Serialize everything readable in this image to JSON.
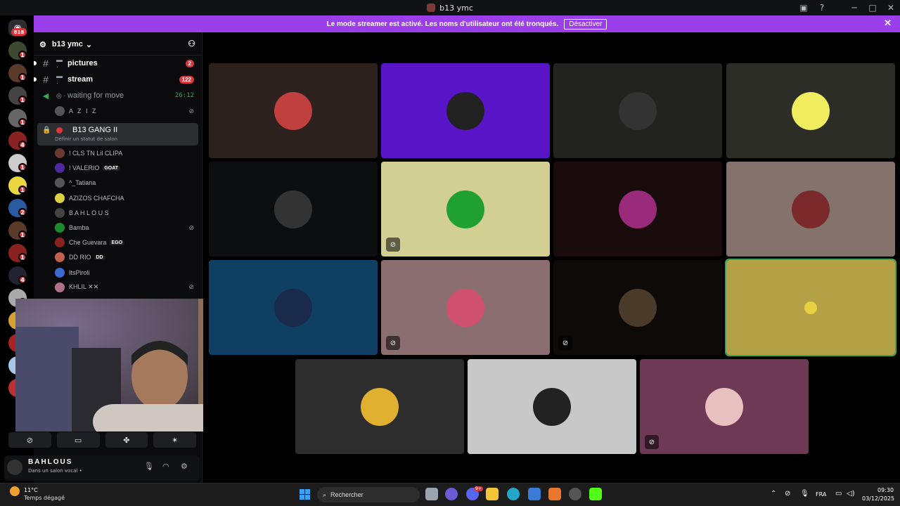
{
  "window": {
    "title": "b13 ymc",
    "controls": [
      "minimize",
      "maximize",
      "close"
    ]
  },
  "banner": {
    "text": "Le mode streamer est activé. Les noms d'utilisateur ont été tronqués.",
    "button": "Désactiver"
  },
  "rail": {
    "home_badge": "818",
    "badges": [
      "1",
      "1",
      "1",
      "1",
      "4",
      "1",
      "1",
      "2",
      "1",
      "1",
      "4",
      "1",
      "1",
      "1",
      "1",
      "1"
    ]
  },
  "server": {
    "name": "b13 ymc"
  },
  "channels": [
    {
      "name": "pictures",
      "count": "2"
    },
    {
      "name": "stream",
      "count": "122"
    },
    {
      "name": "waiting for move",
      "time": "26:12"
    }
  ],
  "waiting_member": "A Z I Z",
  "active_voice": {
    "name": "B13 GANG II",
    "status": "Définir un statut de salon"
  },
  "members": [
    {
      "name": "! CLS TN Lil CLIPA"
    },
    {
      "name": "! VALERIO",
      "tag": "GOAT"
    },
    {
      "name": "^_Tatiana"
    },
    {
      "name": "AZIZOS CHAFCHA"
    },
    {
      "name": "B A H L O U S"
    },
    {
      "name": "Bamba"
    },
    {
      "name": "Che Guevara",
      "tag": "EGO"
    },
    {
      "name": "DD RIO",
      "tag": "DD"
    },
    {
      "name": "ItsPiroli"
    },
    {
      "name": "KHLIL ✕✕"
    }
  ],
  "user": {
    "name": "BAHLOUS",
    "status": "Dans un salon vocal •"
  },
  "tiles_colors": [
    "#2c211d",
    "#5a14c8",
    "#22221e",
    "#2d2d27",
    "#0d0e10",
    "#d2cf94",
    "#1a0b0d",
    "#84726c",
    "#0f4063",
    "#8b6f70",
    "#0d0a08",
    "#b5a145",
    "#2d2d2d",
    "#c8c8c8",
    "#6d3954"
  ],
  "taskbar": {
    "weather_temp": "11°C",
    "weather_desc": "Temps dégagé",
    "search_placeholder": "Rechercher",
    "notif_badge": "9+",
    "lang": "FRA",
    "time": "09:30",
    "date": "03/12/2025"
  }
}
